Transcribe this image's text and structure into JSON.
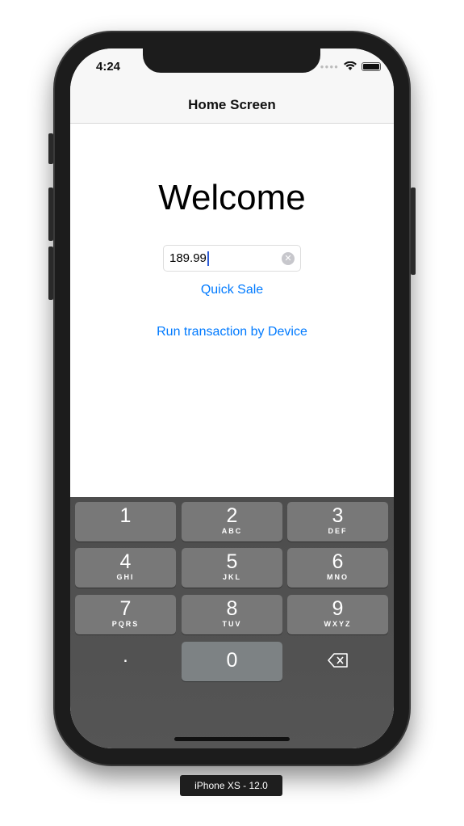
{
  "status": {
    "time": "4:24"
  },
  "nav": {
    "title": "Home Screen"
  },
  "main": {
    "welcome": "Welcome",
    "amount_value": "189.99",
    "quick_sale": "Quick Sale",
    "run_device": "Run transaction by Device"
  },
  "keypad": {
    "keys": [
      {
        "n": "1",
        "l": ""
      },
      {
        "n": "2",
        "l": "ABC"
      },
      {
        "n": "3",
        "l": "DEF"
      },
      {
        "n": "4",
        "l": "GHI"
      },
      {
        "n": "5",
        "l": "JKL"
      },
      {
        "n": "6",
        "l": "MNO"
      },
      {
        "n": "7",
        "l": "PQRS"
      },
      {
        "n": "8",
        "l": "TUV"
      },
      {
        "n": "9",
        "l": "WXYZ"
      },
      {
        "n": ".",
        "l": ""
      },
      {
        "n": "0",
        "l": ""
      },
      {
        "n": "delete-icon",
        "l": ""
      }
    ]
  },
  "device_label": "iPhone XS - 12.0",
  "colors": {
    "accent": "#007aff",
    "key": "#787878",
    "keyboard": "#4f4f4f"
  }
}
